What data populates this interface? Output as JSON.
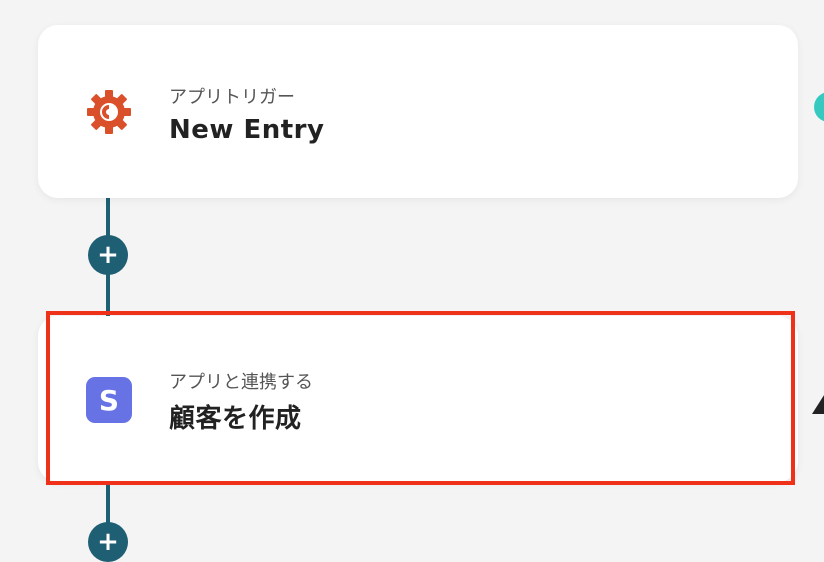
{
  "trigger_card": {
    "subtitle": "アプリトリガー",
    "title": "New Entry",
    "icon": "gear-c-logo-icon",
    "icon_color": "#d9502a"
  },
  "action_card": {
    "subtitle": "アプリと連携する",
    "title": "顧客を作成",
    "icon": "stripe-s-logo-icon",
    "icon_color": "#6772e5",
    "icon_letter": "S"
  },
  "add_step_symbol": "+",
  "colors": {
    "connector": "#1f5f73",
    "highlight": "#f0311a",
    "background": "#f4f4f4"
  }
}
